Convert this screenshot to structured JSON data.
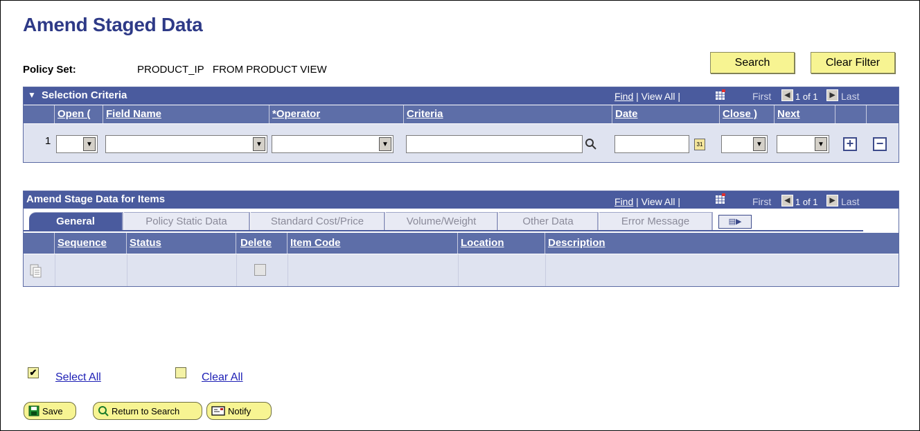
{
  "page": {
    "title": "Amend Staged Data"
  },
  "policy": {
    "label": "Policy Set:",
    "value": "PRODUCT_IP   FROM PRODUCT VIEW"
  },
  "buttons": {
    "search": "Search",
    "clear_filter": "Clear Filter"
  },
  "selection": {
    "title": "Selection Criteria",
    "find": "Find",
    "view_all": "View All",
    "sep": "|",
    "first": "First",
    "count": "1 of 1",
    "last": "Last",
    "columns": [
      "Open (",
      "Field Name",
      "*Operator",
      "Criteria",
      "Date",
      "Close )",
      "Next"
    ],
    "row_number": "1"
  },
  "amend": {
    "title": "Amend Stage Data for Items",
    "find": "Find",
    "view_all": "View All",
    "sep": "|",
    "first": "First",
    "count": "1 of 1",
    "last": "Last",
    "tabs": [
      "General",
      "Policy Static Data",
      "Standard Cost/Price",
      "Volume/Weight",
      "Other Data",
      "Error Message"
    ],
    "active_tab": "General",
    "columns": [
      "Sequence",
      "Status",
      "Delete",
      "Item Code",
      "Location",
      "Description"
    ],
    "delete_checked": false
  },
  "footer": {
    "select_all": "Select All",
    "clear_all": "Clear All",
    "save": "Save",
    "return_to_search": "Return to Search",
    "notify": "Notify"
  },
  "colors": {
    "bar": "#4a5b9e",
    "header": "#5d6ea8",
    "row": "#dfe3f0",
    "button": "#f7f492",
    "title": "#2e3a87"
  }
}
